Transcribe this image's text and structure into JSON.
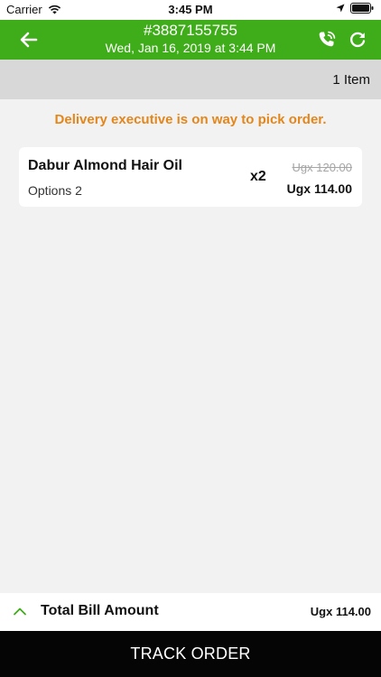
{
  "status_bar": {
    "carrier": "Carrier",
    "time": "3:45 PM"
  },
  "header": {
    "order_number": "#3887155755",
    "timestamp": "Wed, Jan 16, 2019 at 3:44 PM"
  },
  "items_bar": {
    "count_label": "1 Item"
  },
  "order_status": {
    "message": "Delivery executive is on way to pick order.",
    "color": "#e3861b"
  },
  "items": [
    {
      "name": "Dabur Almond Hair Oil",
      "option": "Options 2",
      "quantity": "x2",
      "original_price": "Ugx 120.00",
      "price": "Ugx 114.00"
    }
  ],
  "bill": {
    "label": "Total Bill Amount",
    "amount": "Ugx 114.00"
  },
  "track_button": {
    "label": "TRACK ORDER"
  },
  "icons": {
    "back": "arrow-left-icon",
    "call": "phone-call-icon",
    "refresh": "refresh-icon",
    "expand": "chevron-up-icon"
  },
  "colors": {
    "brand_green": "#3fac1a",
    "track_button_bg": "#050505"
  }
}
